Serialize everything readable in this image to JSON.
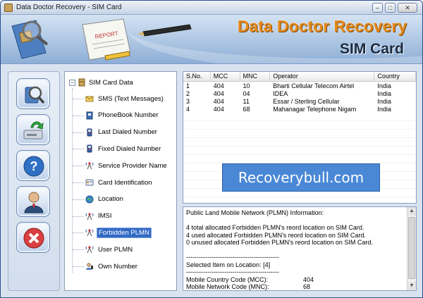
{
  "window": {
    "title": "Data Doctor Recovery - SIM Card",
    "buttons": {
      "minimize": "–",
      "maximize": "□",
      "close": "✕"
    }
  },
  "banner": {
    "brand": "Data Doctor Recovery",
    "subtitle": "SIM Card",
    "paper_label": "REPORT"
  },
  "side_buttons": [
    {
      "name": "search-sim-button",
      "icon": "magnifier-icon"
    },
    {
      "name": "save-button",
      "icon": "drive-save-icon"
    },
    {
      "name": "help-button",
      "icon": "question-icon"
    },
    {
      "name": "about-button",
      "icon": "user-icon"
    },
    {
      "name": "exit-button",
      "icon": "close-icon"
    }
  ],
  "tree": {
    "root": "SIM Card Data",
    "items": [
      {
        "label": "SMS (Text Messages)",
        "icon": "envelope-icon"
      },
      {
        "label": "PhoneBook Number",
        "icon": "phonebook-icon"
      },
      {
        "label": "Last Dialed Number",
        "icon": "phone-icon"
      },
      {
        "label": "Fixed Dialed Number",
        "icon": "phone-icon"
      },
      {
        "label": "Service Provider Name",
        "icon": "antenna-icon"
      },
      {
        "label": "Card Identification",
        "icon": "card-icon"
      },
      {
        "label": "Location",
        "icon": "globe-icon"
      },
      {
        "label": "IMSI",
        "icon": "antenna-icon"
      },
      {
        "label": "Forbidden PLMN",
        "icon": "antenna-icon",
        "selected": true
      },
      {
        "label": "User PLMN",
        "icon": "antenna-icon"
      },
      {
        "label": "Own Number",
        "icon": "phone-person-icon"
      }
    ]
  },
  "table": {
    "columns": [
      "S.No.",
      "MCC",
      "MNC",
      "Operator",
      "Country"
    ],
    "rows": [
      [
        "1",
        "404",
        "10",
        "Bharti Cellular Telecom Airtel",
        "India"
      ],
      [
        "2",
        "404",
        "04",
        "IDEA",
        "India"
      ],
      [
        "3",
        "404",
        "11",
        "Essar / Sterling Cellular",
        "India"
      ],
      [
        "4",
        "404",
        "68",
        "Mahanagar Telephone Nigam",
        "India"
      ]
    ]
  },
  "watermark": "Recoverybull.com",
  "info": {
    "heading": "Public Land Mobile Network (PLMN) Information:",
    "line1": "4 total allocated Forbidden PLMN's reord location on SIM Card.",
    "line2": "4 used allocated Forbidden PLMN's reord location on SIM Card.",
    "line3": "0 unused allocated Forbidden PLMN's reord location on SIM Card.",
    "separator": "--------------------------------------------",
    "selected": "Selected Item on Location: [4]",
    "mcc_label": "Mobile Country Code (MCC):",
    "mcc_value": "404",
    "mnc_label": "Mobile Network Code (MNC):",
    "mnc_value": "68"
  }
}
